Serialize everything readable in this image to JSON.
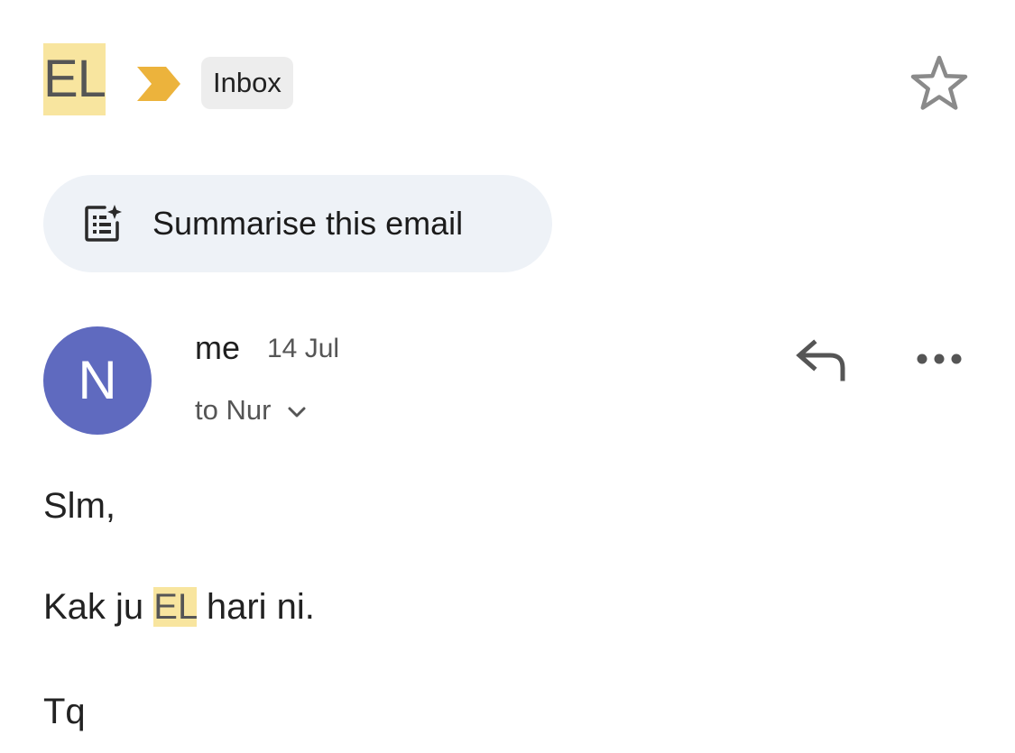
{
  "header": {
    "subject": "EL",
    "label": "Inbox",
    "important_icon": "importance-marker-icon",
    "star_icon": "star-outline-icon"
  },
  "summarise": {
    "label": "Summarise this email",
    "icon": "summarise-sparkle-icon"
  },
  "message": {
    "avatar_initial": "N",
    "sender": "me",
    "date": "14 Jul",
    "recipients": "to Nur",
    "reply_icon": "reply-icon",
    "more_icon": "more-horizontal-icon",
    "body": {
      "greeting": "Slm,",
      "line_before": "Kak ju ",
      "highlight": "EL",
      "line_after": " hari ni.",
      "signoff": "Tq"
    }
  },
  "colors": {
    "highlight": "#f8e59f",
    "avatar": "#5f6abf",
    "important": "#ecb33c",
    "chip": "#ededed",
    "summarise_bg": "#eef2f7"
  }
}
